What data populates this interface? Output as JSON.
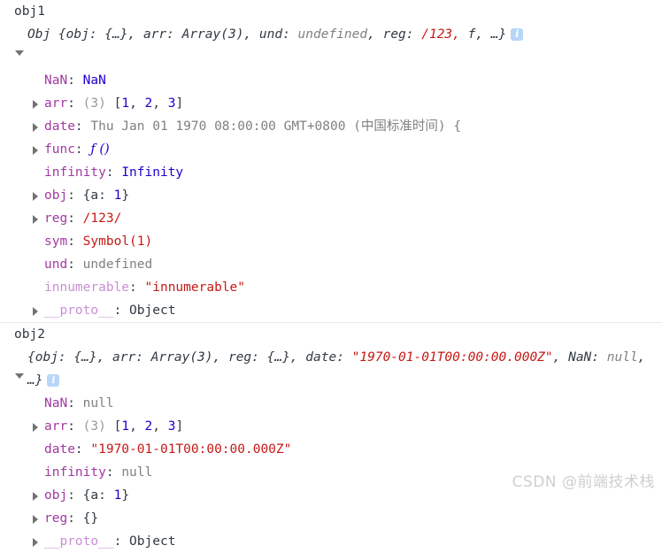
{
  "groups": [
    {
      "label": "obj1",
      "header": {
        "ctor": "Obj ",
        "parts": [
          {
            "t": "{obj: {…}, arr: Array(3), und: ",
            "c": "preview-b"
          },
          {
            "t": "undefined",
            "c": "preview"
          },
          {
            "t": ", reg: ",
            "c": "preview-b"
          },
          {
            "t": "/123,",
            "c": "preview-re"
          },
          {
            "t": "\nf, …}",
            "c": "preview-b"
          }
        ],
        "info_icon": "info-icon",
        "info_glyph": "i",
        "expanded": true
      },
      "rows": [
        {
          "expandable": false,
          "key": "NaN",
          "key_style": "k-name",
          "value": "NaN",
          "value_style": "v-num"
        },
        {
          "expandable": true,
          "key": "arr",
          "key_style": "k-name",
          "value": "(3) [1, 2, 3]",
          "value_style": "array"
        },
        {
          "expandable": true,
          "key": "date",
          "key_style": "k-name",
          "value": "Thu Jan 01 1970 08:00:00 GMT+0800 (中国标准时间) {",
          "value_style": "v-grey"
        },
        {
          "expandable": true,
          "key": "func",
          "key_style": "k-name",
          "value": "ƒ ()",
          "value_style": "fn"
        },
        {
          "expandable": false,
          "key": "infinity",
          "key_style": "k-name",
          "value": "Infinity",
          "value_style": "v-num"
        },
        {
          "expandable": true,
          "key": "obj",
          "key_style": "k-name",
          "value": "{a: 1}",
          "value_style": "objlit"
        },
        {
          "expandable": true,
          "key": "reg",
          "key_style": "k-name",
          "value": "/123/",
          "value_style": "v-regex"
        },
        {
          "expandable": false,
          "key": "sym",
          "key_style": "k-name",
          "value": "Symbol(1)",
          "value_style": "v-sym"
        },
        {
          "expandable": false,
          "key": "und",
          "key_style": "k-name",
          "value": "undefined",
          "value_style": "v-undef"
        },
        {
          "expandable": false,
          "key": "innumerable",
          "key_style": "k-dim",
          "value": "\"innumerable\"",
          "value_style": "v-str"
        },
        {
          "expandable": true,
          "key": "__proto__",
          "key_style": "k-dim",
          "value": "Object",
          "value_style": "v-obj"
        }
      ]
    },
    {
      "label": "obj2",
      "header": {
        "ctor": "",
        "parts": [
          {
            "t": "{obj: {…}, arr: Array(3), reg: {…}, date:\n",
            "c": "preview-b"
          },
          {
            "t": "\"1970-01-01T00:00:00.000Z\"",
            "c": "preview-str"
          },
          {
            "t": ", NaN: ",
            "c": "preview-b"
          },
          {
            "t": "null",
            "c": "preview"
          },
          {
            "t": ", …}",
            "c": "preview-b"
          }
        ],
        "info_icon": "info-icon",
        "info_glyph": "i",
        "expanded": true
      },
      "rows": [
        {
          "expandable": false,
          "key": "NaN",
          "key_style": "k-name",
          "value": "null",
          "value_style": "v-null"
        },
        {
          "expandable": true,
          "key": "arr",
          "key_style": "k-name",
          "value": "(3) [1, 2, 3]",
          "value_style": "array"
        },
        {
          "expandable": false,
          "key": "date",
          "key_style": "k-name",
          "value": "\"1970-01-01T00:00:00.000Z\"",
          "value_style": "v-str"
        },
        {
          "expandable": false,
          "key": "infinity",
          "key_style": "k-name",
          "value": "null",
          "value_style": "v-null"
        },
        {
          "expandable": true,
          "key": "obj",
          "key_style": "k-name",
          "value": "{a: 1}",
          "value_style": "objlit"
        },
        {
          "expandable": true,
          "key": "reg",
          "key_style": "k-name",
          "value": "{}",
          "value_style": "objlit-empty"
        },
        {
          "expandable": true,
          "key": "__proto__",
          "key_style": "k-dim",
          "value": "Object",
          "value_style": "v-obj"
        }
      ]
    }
  ],
  "watermark": "CSDN @前端技术栈",
  "colors": {
    "key": "#a238a2",
    "key_dim": "#c98fd4",
    "string": "#c41a16",
    "number": "#1c00cf",
    "grey": "#808080",
    "text": "#303942",
    "info_badge": "#b6d7f7",
    "divider": "#ebebeb"
  }
}
